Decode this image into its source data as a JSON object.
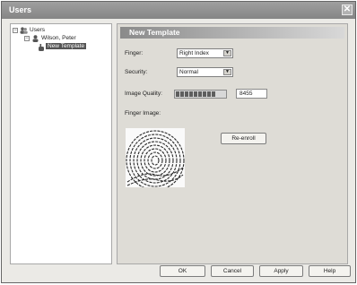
{
  "window": {
    "title": "Users"
  },
  "tree": {
    "root_label": "Users",
    "user_label": "Wilson, Peter",
    "template_label": "New Template"
  },
  "panel": {
    "title": "New Template",
    "finger_label": "Finger:",
    "finger_value": "Right Index",
    "security_label": "Security:",
    "security_value": "Normal",
    "quality_label": "Image Quality:",
    "quality_value": "8455",
    "finger_image_label": "Finger Image:",
    "reenroll_label": "Re-enroll"
  },
  "buttons": {
    "ok": "OK",
    "cancel": "Cancel",
    "apply": "Apply",
    "help": "Help"
  }
}
